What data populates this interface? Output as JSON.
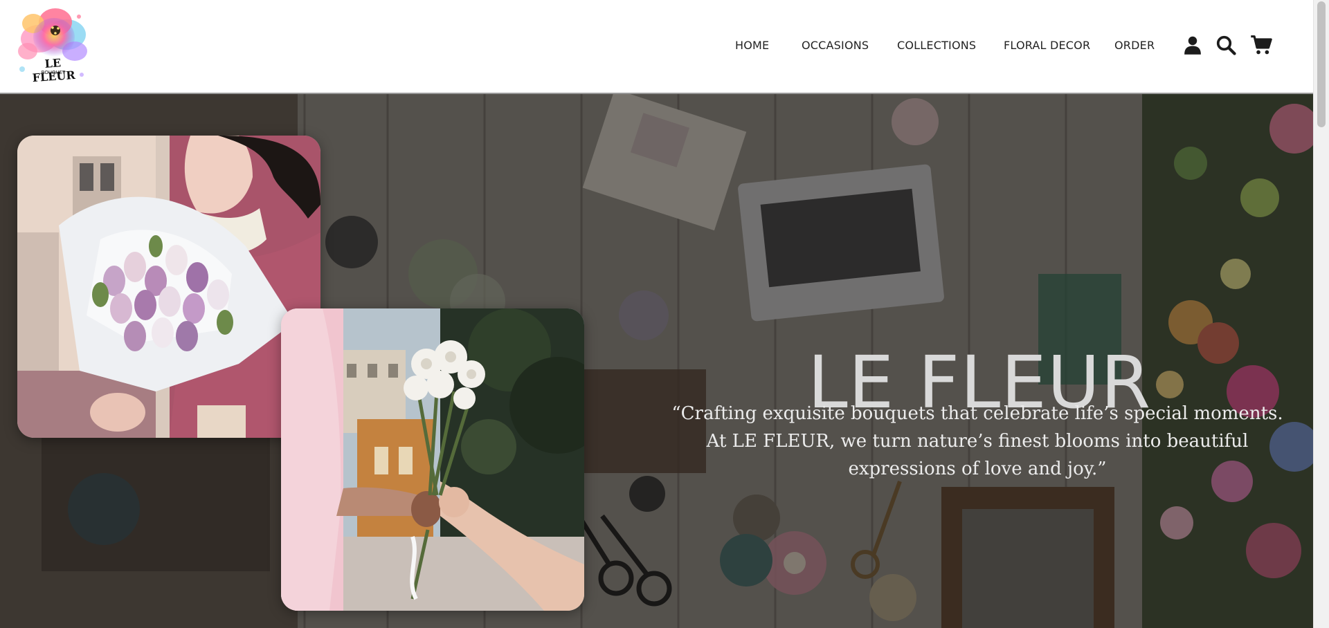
{
  "brand": {
    "logo_text": "LE FLEUR",
    "logo_subtext": "BOUQUET",
    "colors": {
      "primary_text": "#222222",
      "hero_title": "#d9d9d9",
      "hero_overlay": "#1e1c1a"
    }
  },
  "nav": {
    "items": [
      {
        "label": "HOME"
      },
      {
        "label": "OCCASIONS"
      },
      {
        "label": "COLLECTIONS"
      },
      {
        "label": "FLORAL DECOR"
      },
      {
        "label": "ORDER"
      }
    ],
    "icons": [
      "user-icon",
      "search-icon",
      "cart-icon"
    ]
  },
  "hero": {
    "title": "LE FLEUR",
    "quote": "“Crafting exquisite bouquets that celebrate life’s special moments. At LE FLEUR, we turn nature’s finest blooms into beautiful expressions of love and joy.”"
  }
}
